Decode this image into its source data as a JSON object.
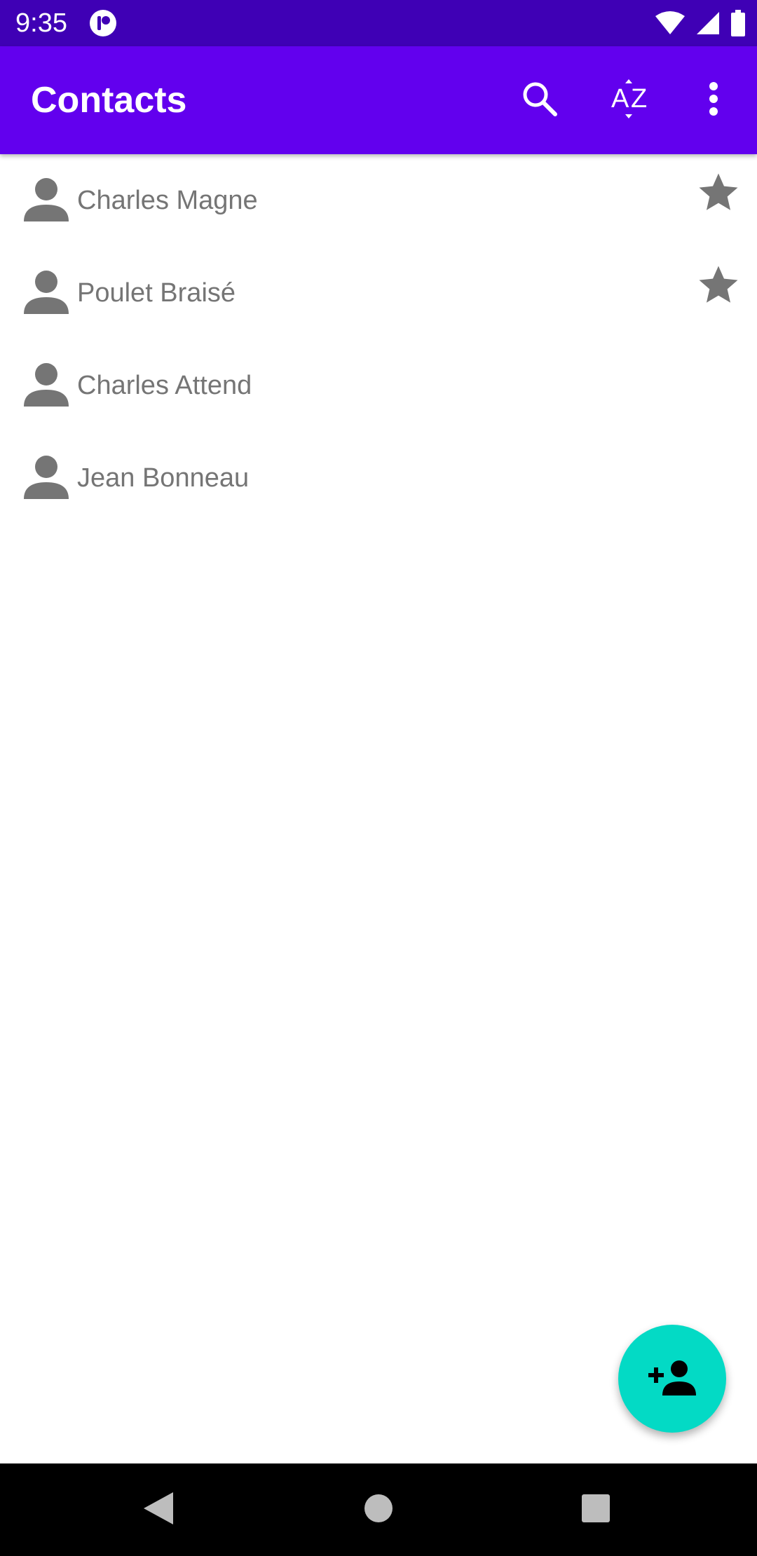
{
  "status_bar": {
    "time": "9:35",
    "icons": [
      "app-notification-icon",
      "wifi-icon",
      "cell-signal-icon",
      "battery-icon"
    ]
  },
  "app_bar": {
    "title": "Contacts",
    "actions": [
      "search-icon",
      "sort-az-icon",
      "more-vert-icon"
    ]
  },
  "contacts": [
    {
      "name": "Charles Magne",
      "favorite": true
    },
    {
      "name": "Poulet Braisé",
      "favorite": true
    },
    {
      "name": "Charles Attend",
      "favorite": false
    },
    {
      "name": "Jean Bonneau",
      "favorite": false
    }
  ],
  "fab": {
    "icon": "person-add-icon"
  },
  "nav_bar": {
    "buttons": [
      "back-icon",
      "home-icon",
      "recents-icon"
    ]
  },
  "colors": {
    "status_bar": "#3f00b5",
    "app_bar": "#6200ee",
    "fab": "#03dac5",
    "text_secondary": "#757575",
    "icon_gray": "#757575",
    "nav_bar": "#000000"
  }
}
